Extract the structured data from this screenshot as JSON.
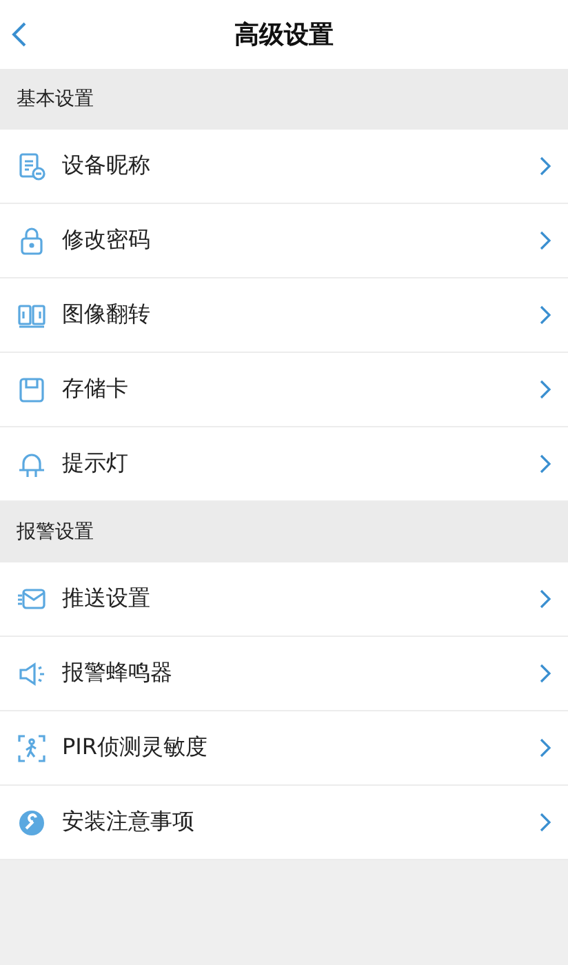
{
  "header": {
    "title": "高级设置"
  },
  "sections": [
    {
      "title": "基本设置",
      "items": [
        {
          "label": "设备昵称"
        },
        {
          "label": "修改密码"
        },
        {
          "label": "图像翻转"
        },
        {
          "label": "存储卡"
        },
        {
          "label": "提示灯"
        }
      ]
    },
    {
      "title": "报警设置",
      "items": [
        {
          "label": "推送设置"
        },
        {
          "label": "报警蜂鸣器"
        },
        {
          "label": "PIR侦测灵敏度"
        },
        {
          "label": "安装注意事项"
        }
      ]
    }
  ]
}
